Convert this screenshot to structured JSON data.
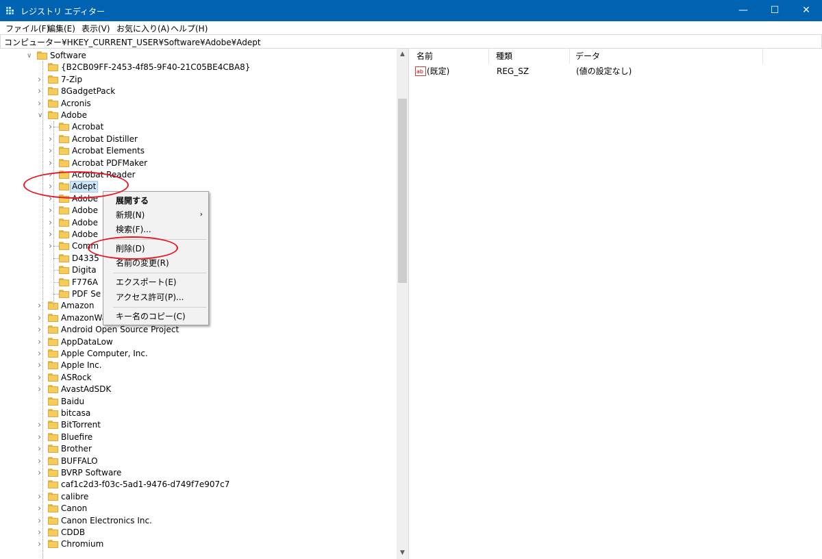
{
  "window": {
    "title": "レジストリ エディター",
    "icon": "regedit-icon",
    "colors": {
      "titlebar": "#0063b1",
      "highlight": "#cce8ff",
      "annotation": "#e8141e"
    },
    "buttons": {
      "minimize": "—",
      "maximize": "☐",
      "close": "✕"
    }
  },
  "menu": [
    "ファイル(F)",
    "編集(E)",
    "表示(V)",
    "お気に入り(A)",
    "ヘルプ(H)"
  ],
  "address": "コンピューター¥HKEY_CURRENT_USER¥Software¥Adobe¥Adept",
  "tree": {
    "software": "Software",
    "level1_top": [
      "{B2CB09FF-2453-4f85-9F40-21C05BE4CBA8}",
      "7-Zip",
      "8GadgetPack",
      "Acronis",
      "Adobe"
    ],
    "adobe_children": [
      "Acrobat",
      "Acrobat Distiller",
      "Acrobat Elements",
      "Acrobat PDFMaker",
      "Acrobat Reader",
      "Adept",
      "Adobe",
      "Adobe",
      "Adobe",
      "Adobe",
      "Comm",
      "D4335",
      "Digita",
      "F776A",
      "PDF Se"
    ],
    "level1_rest": [
      "Amazon",
      "AmazonWatcher",
      "Android Open Source Project",
      "AppDataLow",
      "Apple Computer, Inc.",
      "Apple Inc.",
      "ASRock",
      "AvastAdSDK",
      "Baidu",
      "bitcasa",
      "BitTorrent",
      "Bluefire",
      "Brother",
      "BUFFALO",
      "BVRP Software",
      "caf1c2d3-f03c-5ad1-9476-d749f7e907c7",
      "calibre",
      "Canon",
      "Canon Electronics Inc.",
      "CDDB",
      "Chromium"
    ]
  },
  "list": {
    "headers": [
      "名前",
      "種類",
      "データ"
    ],
    "rows": [
      {
        "name": "(既定)",
        "type": "REG_SZ",
        "data": "(値の設定なし)",
        "icon": "string-value-icon"
      }
    ]
  },
  "context_menu": {
    "items": [
      "展開する",
      "新規(N)",
      "検索(F)...",
      "削除(D)",
      "名前の変更(R)",
      "エクスポート(E)",
      "アクセス許可(P)...",
      "キー名のコピー(C)"
    ],
    "submenu_arrow": "›"
  },
  "scrollbar": {
    "up": "▲",
    "down": "▼"
  }
}
